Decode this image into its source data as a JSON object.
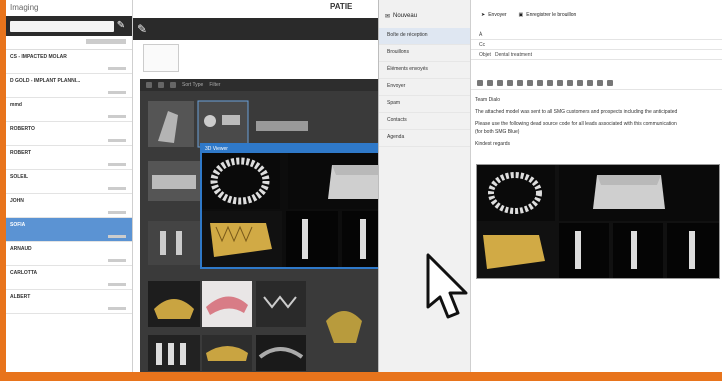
{
  "app": {
    "title": "Imaging",
    "header_text": "PATIE"
  },
  "patients": [
    {
      "name": "CS - IMPACTED MOLAR"
    },
    {
      "name": "D GOLD - IMPLANT PLANNI..."
    },
    {
      "name": "mmd"
    },
    {
      "name": "ROBERTO"
    },
    {
      "name": "ROBERT"
    },
    {
      "name": "SOLEIL"
    },
    {
      "name": "JOHN"
    },
    {
      "name": "SOFIA",
      "selected": true
    },
    {
      "name": "ARNAUD"
    },
    {
      "name": "CARLOTTA"
    },
    {
      "name": "ALBERT"
    }
  ],
  "browser": {
    "labels": [
      "Sort Type",
      "Filter"
    ]
  },
  "viewer3d": {
    "title": "3D Viewer"
  },
  "mail": {
    "new_label": "Nouveau",
    "nav": [
      "Boîte de réception",
      "Brouillons",
      "Éléments envoyés",
      "Envoyer",
      "Spam",
      "Contacts",
      "Agenda"
    ],
    "toolbar": [
      "Envoyer",
      "Enregistrer le brouillon"
    ],
    "fields": [
      {
        "key": "À",
        "value": ""
      },
      {
        "key": "Cc",
        "value": ""
      },
      {
        "key": "Objet",
        "value": "Dental treatment"
      }
    ],
    "body": [
      "Team Dialo",
      "The attached model was sent to all SMG customers and prospects including the anticipated",
      "Please use the following dead source code for all leads associated with this communication",
      "(for both SMG Blue)",
      "Kindest regards"
    ]
  },
  "colors": {
    "accent": "#e8741c",
    "selection": "#5b93d3",
    "window_border": "#2f79c9"
  },
  "icons": [
    "search-icon",
    "cursor-icon",
    "compose-icon",
    "send-icon",
    "save-icon",
    "close-icon"
  ]
}
